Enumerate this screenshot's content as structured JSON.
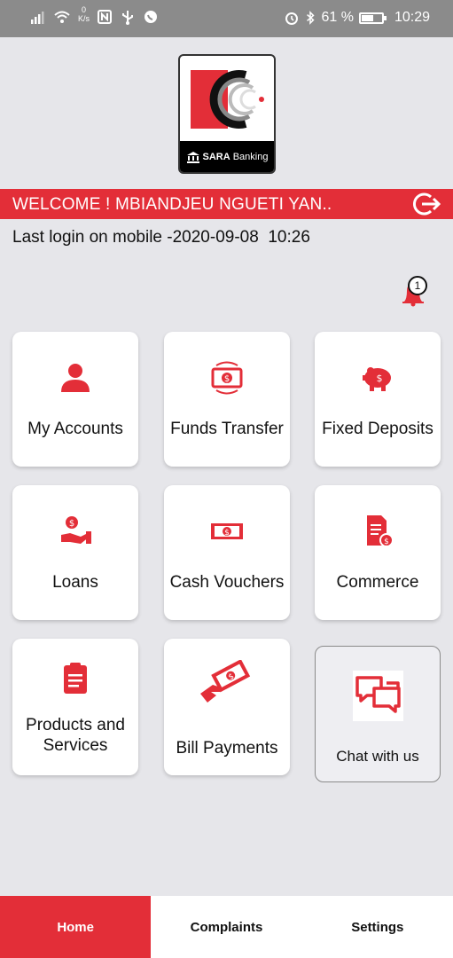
{
  "status_bar": {
    "netspeed_value": "0",
    "netspeed_unit": "K/s",
    "battery_percent": "61 %",
    "battery_level": 0.61,
    "time": "10:29"
  },
  "logo": {
    "brand_bold": "SARA",
    "brand_light": "Banking"
  },
  "welcome": {
    "text": "WELCOME !  MBIANDJEU NGUETI YAN.."
  },
  "last_login": "Last login on mobile -2020-09-08  10:26",
  "notifications": {
    "count": "1"
  },
  "tiles": [
    {
      "label": "My Accounts",
      "icon": "user-icon"
    },
    {
      "label": "Funds Transfer",
      "icon": "money-transfer-icon"
    },
    {
      "label": "Fixed Deposits",
      "icon": "piggy-bank-icon"
    },
    {
      "label": "Loans",
      "icon": "hand-coin-icon"
    },
    {
      "label": "Cash Vouchers",
      "icon": "banknote-icon"
    },
    {
      "label": "Commerce",
      "icon": "invoice-icon"
    },
    {
      "label": "Products and Services",
      "icon": "clipboard-icon"
    },
    {
      "label": "Bill Payments",
      "icon": "hand-cash-icon"
    },
    {
      "label": "Chat with us",
      "icon": "chat-icon"
    }
  ],
  "bottom_nav": [
    {
      "label": "Home",
      "active": true
    },
    {
      "label": "Complaints",
      "active": false
    },
    {
      "label": "Settings",
      "active": false
    }
  ],
  "colors": {
    "accent": "#e32e38",
    "background": "#e6e6ea",
    "status_bar": "#8b8b8b"
  }
}
